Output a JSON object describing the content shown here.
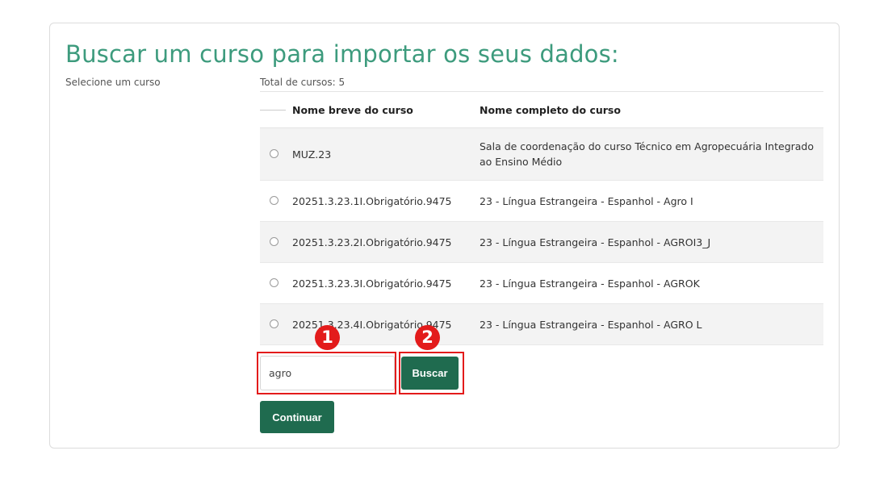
{
  "page": {
    "title": "Buscar um curso para importar os seus dados:",
    "side_label": "Selecione um curso",
    "total_label": "Total de cursos: 5"
  },
  "table": {
    "headers": {
      "short_name": "Nome breve do curso",
      "full_name": "Nome completo do curso"
    },
    "rows": [
      {
        "short_name": "MUZ.23",
        "full_name": "Sala de coordenação do curso Técnico em Agropecuária Integrado ao Ensino Médio"
      },
      {
        "short_name": "20251.3.23.1I.Obrigatório.9475",
        "full_name": "23 - Língua Estrangeira - Espanhol - Agro I"
      },
      {
        "short_name": "20251.3.23.2I.Obrigatório.9475",
        "full_name": "23 - Língua Estrangeira - Espanhol - AGROI3_J"
      },
      {
        "short_name": "20251.3.23.3I.Obrigatório.9475",
        "full_name": "23 - Língua Estrangeira - Espanhol - AGROK"
      },
      {
        "short_name": "20251.3.23.4I.Obrigatório.9475",
        "full_name": "23 - Língua Estrangeira - Espanhol - AGRO L"
      }
    ]
  },
  "search": {
    "value": "agro",
    "button_label": "Buscar"
  },
  "continue_label": "Continuar",
  "annotations": {
    "step1": "1",
    "step2": "2"
  },
  "colors": {
    "title": "#3d9b7d",
    "button": "#1f6b4f",
    "highlight": "#e31b1b"
  }
}
